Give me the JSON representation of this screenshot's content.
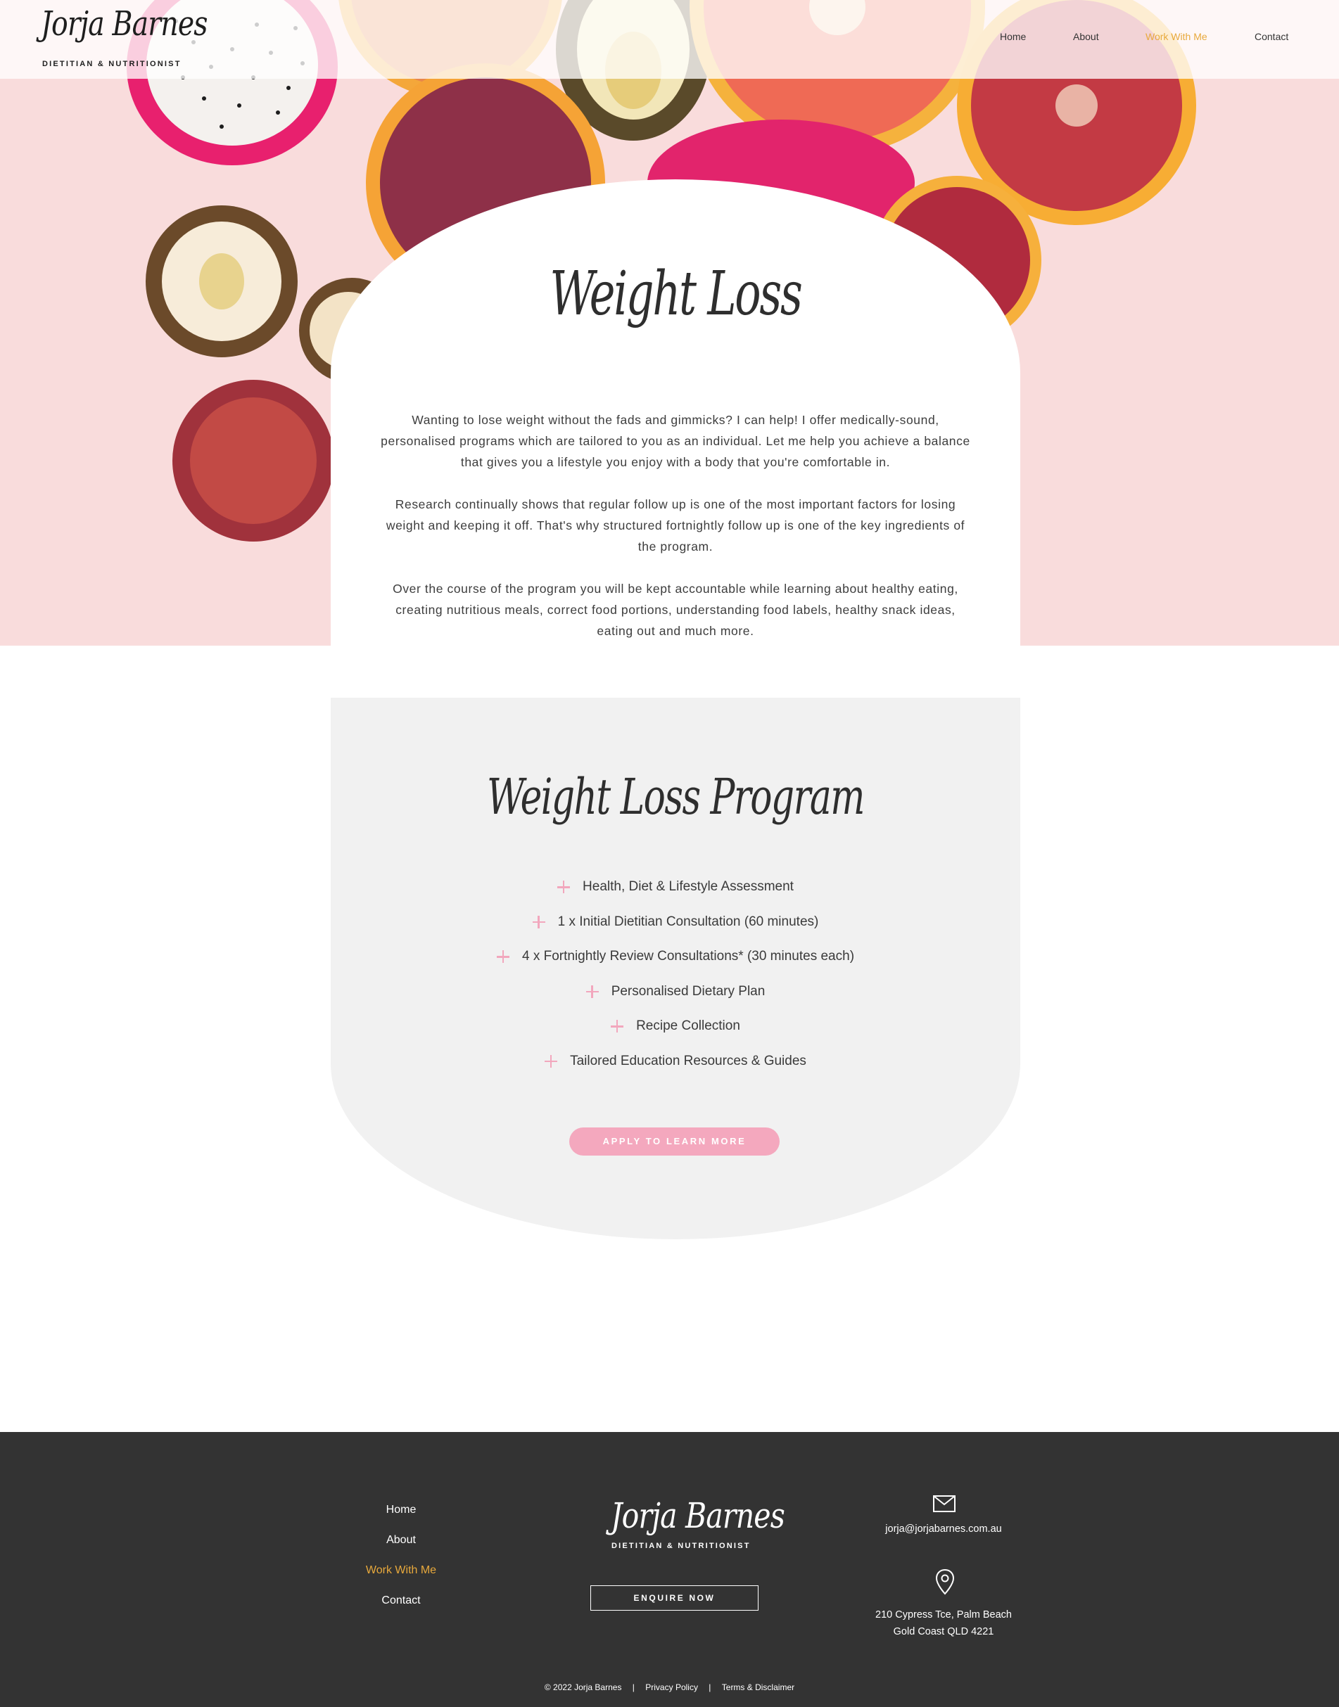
{
  "brand": {
    "name": "Jorja Barnes",
    "tagline": "DIETITIAN & NUTRITIONIST"
  },
  "nav": {
    "items": [
      {
        "label": "Home",
        "active": false
      },
      {
        "label": "About",
        "active": false
      },
      {
        "label": "Work With Me",
        "active": true
      },
      {
        "label": "Contact",
        "active": false
      }
    ]
  },
  "colors": {
    "accent": "#e8a93c",
    "pink": "#f4a8be",
    "footer_bg": "#333333",
    "hero_bg": "#f9dcdc"
  },
  "weight_loss": {
    "title": "Weight Loss",
    "paragraphs": [
      "Wanting to lose weight without the fads and gimmicks? I can help! I offer medically-sound, personalised programs which are tailored to you as an individual. Let me help you achieve a balance that gives you a lifestyle you enjoy with a body that you're comfortable in.",
      "Research continually shows that regular follow up is one of the most important factors for losing weight and keeping it off. That's why structured fortnightly follow up is one of the key ingredients of the program.",
      "Over the course of the program you will be kept accountable while learning about healthy eating, creating nutritious meals, correct food portions, understanding food labels, healthy snack ideas, eating out and much more."
    ]
  },
  "program": {
    "title": "Weight Loss Program",
    "items": [
      "Health, Diet & Lifestyle Assessment",
      "1 x Initial Dietitian Consultation (60 minutes)",
      "4 x Fortnightly Review Consultations* (30 minutes each)",
      "Personalised Dietary Plan",
      "Recipe Collection",
      "Tailored Education Resources & Guides"
    ],
    "cta_label": "APPLY TO LEARN MORE"
  },
  "footer": {
    "nav": [
      {
        "label": "Home",
        "active": false
      },
      {
        "label": "About",
        "active": false
      },
      {
        "label": "Work With Me",
        "active": true
      },
      {
        "label": "Contact",
        "active": false
      }
    ],
    "enquire_label": "ENQUIRE NOW",
    "email": "jorja@jorjabarnes.com.au",
    "address_line1": "210 Cypress Tce, Palm Beach",
    "address_line2": "Gold Coast QLD 4221",
    "copyright": "© 2022 Jorja Barnes",
    "privacy_label": "Privacy Policy",
    "terms_label": "Terms & Disclaimer",
    "separator": "|"
  }
}
